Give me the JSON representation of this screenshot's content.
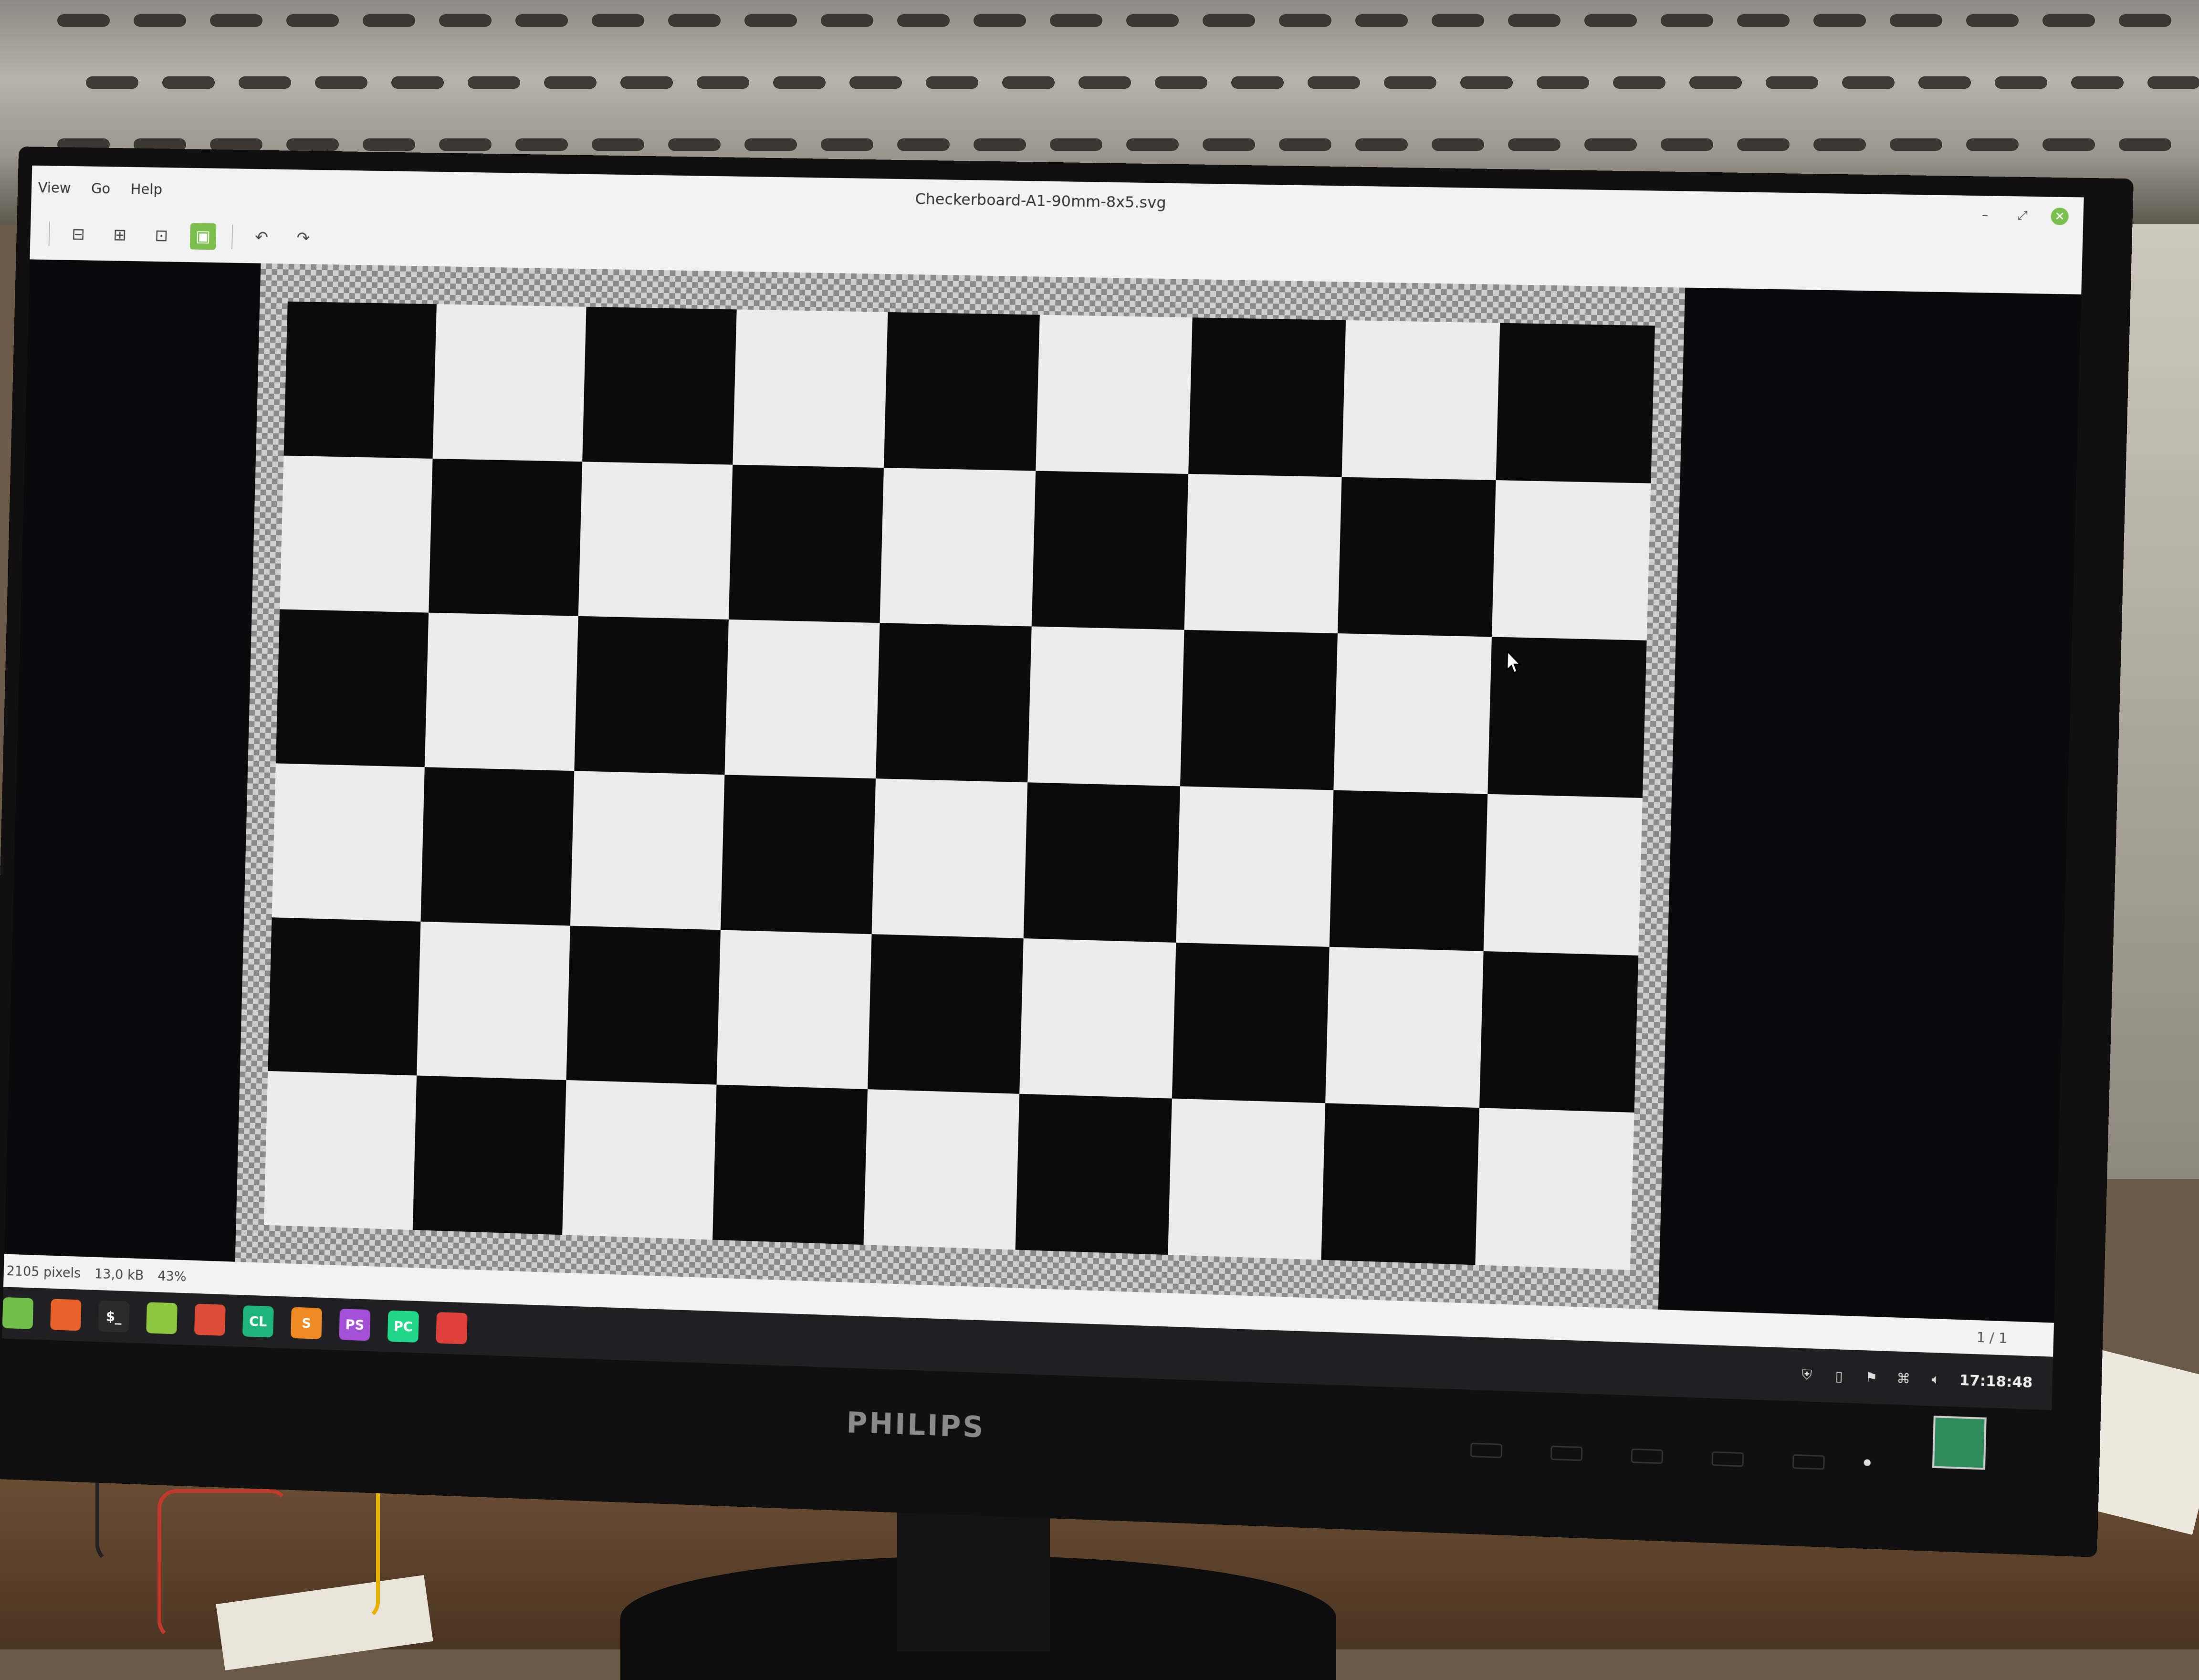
{
  "menu": [
    "View",
    "Go",
    "Help"
  ],
  "window": {
    "title": "Checkerboard-A1-90mm-8x5.svg"
  },
  "statusbar": {
    "dimensions": "2105 pixels",
    "size": "13,0 kB",
    "zoom": "43%",
    "page": "1 / 1"
  },
  "taskbar": {
    "apps": [
      {
        "name": "mint-menu",
        "glyph": "",
        "color": "#6fbf4a"
      },
      {
        "name": "firefox",
        "glyph": "",
        "color": "#e8622a"
      },
      {
        "name": "terminal",
        "glyph": "$_",
        "color": "#2b2b2b"
      },
      {
        "name": "files",
        "glyph": "",
        "color": "#8dc63f"
      },
      {
        "name": "chrome",
        "glyph": "",
        "color": "#dd4b39"
      },
      {
        "name": "clion",
        "glyph": "CL",
        "color": "#20b57a"
      },
      {
        "name": "sublime",
        "glyph": "S",
        "color": "#f08a24"
      },
      {
        "name": "phpstorm",
        "glyph": "PS",
        "color": "#a34fd6"
      },
      {
        "name": "pycharm",
        "glyph": "PC",
        "color": "#21d789"
      },
      {
        "name": "image-viewer",
        "glyph": "",
        "color": "#e0413b"
      }
    ],
    "clock": "17:18:48"
  },
  "monitor": {
    "brand": "PHILIPS"
  },
  "board": {
    "cols": 9,
    "rows": 6,
    "first_black": true
  },
  "colors": {
    "accent": "#7bbf4f",
    "black_square": "#0b0b0b",
    "white_square": "#ececec"
  }
}
